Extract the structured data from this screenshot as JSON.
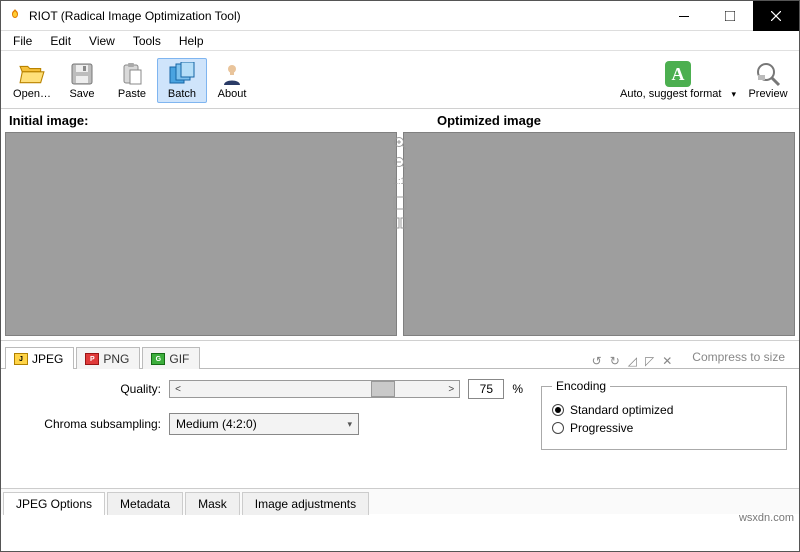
{
  "window": {
    "title": "RIOT (Radical Image Optimization Tool)"
  },
  "menu": {
    "file": "File",
    "edit": "Edit",
    "view": "View",
    "tools": "Tools",
    "help": "Help"
  },
  "toolbar": {
    "open": "Open…",
    "save": "Save",
    "paste": "Paste",
    "batch": "Batch",
    "about": "About",
    "auto": "Auto, suggest format",
    "preview": "Preview"
  },
  "panels": {
    "initial_header": "Initial image:",
    "optimized_header": "Optimized image",
    "side_ratio": "1:1"
  },
  "format_tabs": {
    "jpeg": "JPEG",
    "png": "PNG",
    "gif": "GIF"
  },
  "compress_link": "Compress to size",
  "options": {
    "quality_label": "Quality:",
    "quality_value": "75",
    "quality_percent": "%",
    "chroma_label": "Chroma subsampling:",
    "chroma_value": "Medium (4:2:0)",
    "encoding_legend": "Encoding",
    "encoding_standard": "Standard optimized",
    "encoding_progressive": "Progressive"
  },
  "bottom_tabs": {
    "jpeg_options": "JPEG Options",
    "metadata": "Metadata",
    "mask": "Mask",
    "image_adjustments": "Image adjustments"
  },
  "watermark": "wsxdn.com"
}
